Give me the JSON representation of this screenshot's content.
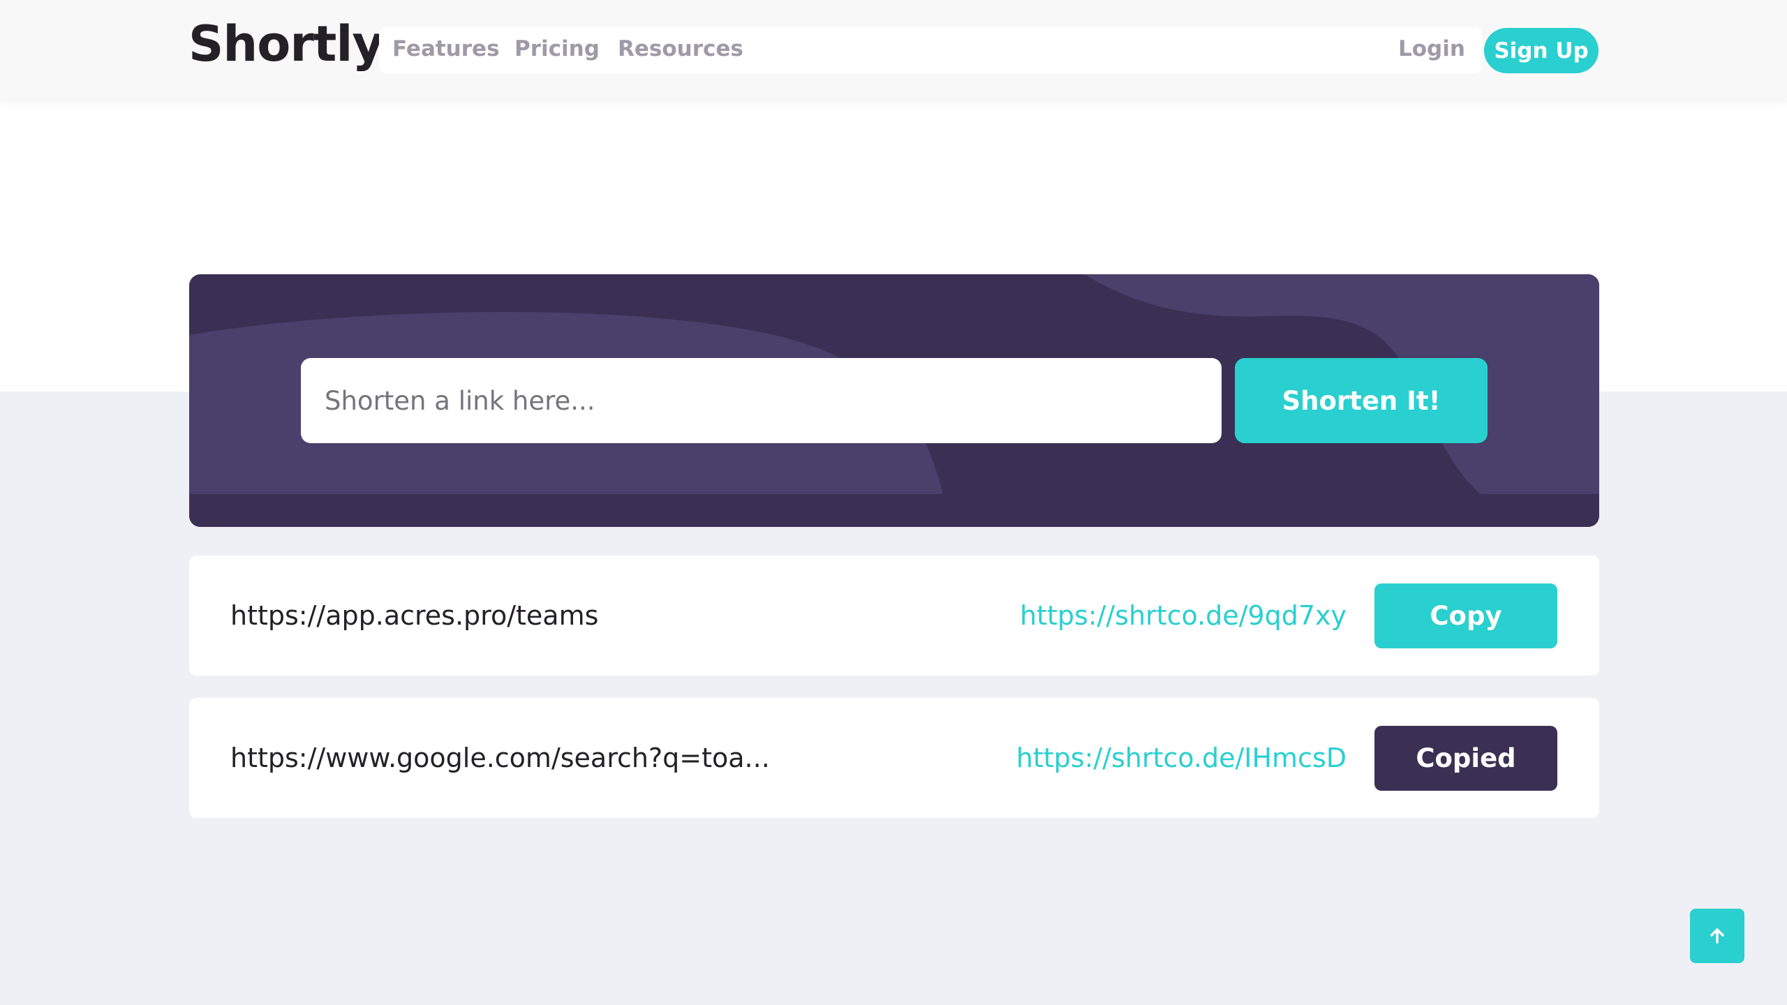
{
  "header": {
    "logo": "Shortly",
    "nav": {
      "features": "Features",
      "pricing": "Pricing",
      "resources": "Resources",
      "login": "Login",
      "signup": "Sign Up"
    }
  },
  "shortener": {
    "placeholder": "Shorten a link here...",
    "button_label": "Shorten It!"
  },
  "results": [
    {
      "original": "https://app.acres.pro/teams",
      "short": "https://shrtco.de/9qd7xy",
      "button_label": "Copy"
    },
    {
      "original": "https://www.google.com/search?q=toa...",
      "short": "https://shrtco.de/IHmcsD",
      "button_label": "Copied"
    }
  ],
  "scroll_top_icon": "arrow-up-icon",
  "colors": {
    "primary_cyan": "#2acfcf",
    "dark_violet": "#3b3054",
    "background": "#eff0f5"
  }
}
